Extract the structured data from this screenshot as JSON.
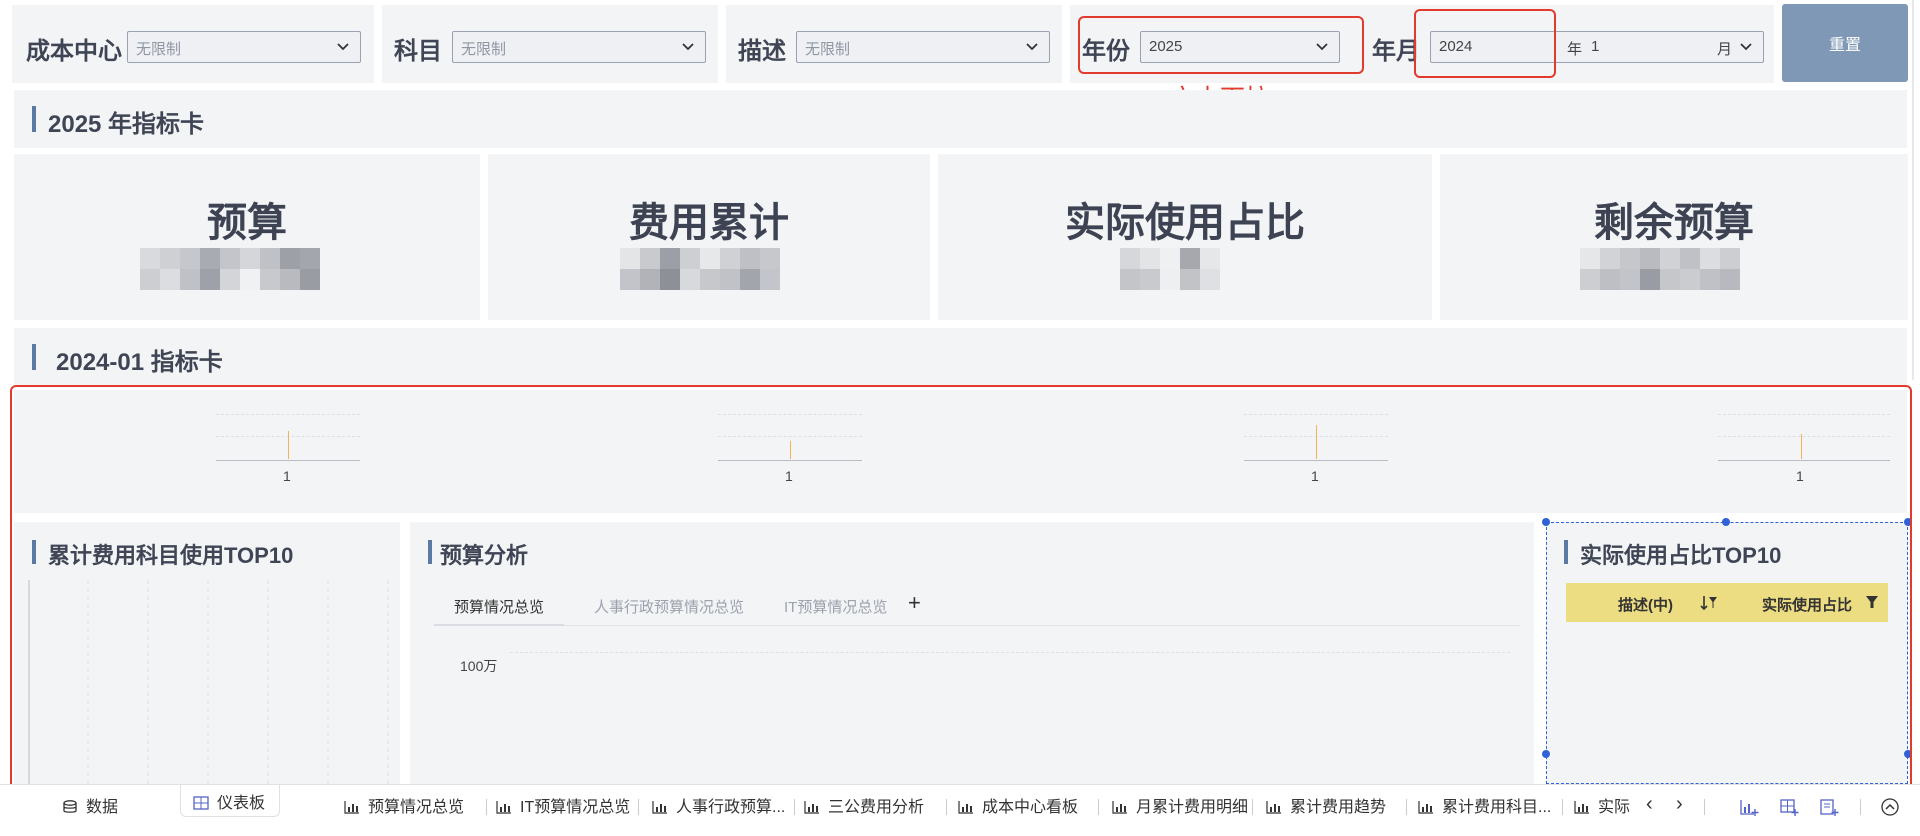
{
  "filters": {
    "cost_center": {
      "label": "成本中心",
      "value": "无限制"
    },
    "subject": {
      "label": "科目",
      "value": "无限制"
    },
    "description": {
      "label": "描述",
      "value": "无限制"
    },
    "year": {
      "label": "年份",
      "value": "2025"
    },
    "year_month": {
      "label": "年月",
      "year_value": "2024",
      "year_unit": "年",
      "month_value": "1",
      "month_unit": "月"
    },
    "reset_label": "重置"
  },
  "annotation_note": "文本下拉",
  "section_year": {
    "title": "2025 年指标卡"
  },
  "kpis": [
    {
      "title": "预算"
    },
    {
      "title": "费用累计"
    },
    {
      "title": "实际使用占比"
    },
    {
      "title": "剩余预算"
    }
  ],
  "section_month": {
    "title": "2024-01 指标卡"
  },
  "mini_charts": [
    {
      "category": "1"
    },
    {
      "category": "1"
    },
    {
      "category": "1"
    },
    {
      "category": "1"
    }
  ],
  "panels": {
    "top10_cost": {
      "title": "累计费用科目使用TOP10"
    },
    "budget_analysis": {
      "title": "预算分析",
      "tabs": [
        "预算情况总览",
        "人事行政预算情况总览",
        "IT预算情况总览"
      ],
      "active_tab": "预算情况总览",
      "y_tick": "100万"
    },
    "usage_top10": {
      "title": "实际使用占比TOP10",
      "columns": [
        "描述(中)",
        "实际使用占比"
      ]
    }
  },
  "sheet_tabs": [
    {
      "label": "数据",
      "icon": "database-icon"
    },
    {
      "label": "仪表板",
      "icon": "dashboard-icon",
      "active": true
    },
    {
      "label": "预算情况总览",
      "icon": "bar-chart-icon"
    },
    {
      "label": "IT预算情况总览",
      "icon": "bar-chart-icon"
    },
    {
      "label": "人事行政预算...",
      "icon": "bar-chart-icon"
    },
    {
      "label": "三公费用分析",
      "icon": "bar-chart-icon"
    },
    {
      "label": "成本中心看板",
      "icon": "bar-chart-icon"
    },
    {
      "label": "月累计费用明细",
      "icon": "bar-chart-icon"
    },
    {
      "label": "累计费用趋势",
      "icon": "bar-chart-icon"
    },
    {
      "label": "累计费用科目...",
      "icon": "bar-chart-icon"
    },
    {
      "label": "实际",
      "icon": "bar-chart-icon"
    }
  ],
  "colors": {
    "accent": "#5a7aa3",
    "annotation": "#e23b2e",
    "reset": "#7f98b6",
    "table_header": "#ecdc82"
  }
}
